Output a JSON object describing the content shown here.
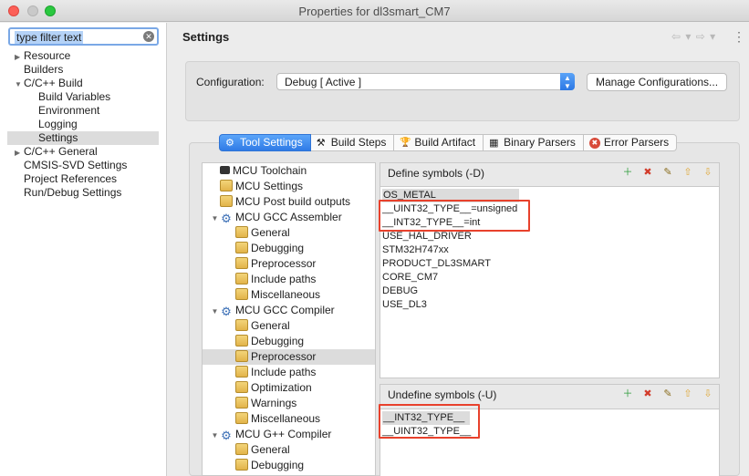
{
  "window": {
    "title": "Properties for dl3smart_CM7"
  },
  "filter": {
    "text": "type filter text"
  },
  "nav_tree": [
    {
      "label": "Resource",
      "twisty": "▶"
    },
    {
      "label": "Builders",
      "twisty": ""
    },
    {
      "label": "C/C++ Build",
      "twisty": "▼"
    },
    {
      "label": "Build Variables",
      "twisty": ""
    },
    {
      "label": "Environment",
      "twisty": ""
    },
    {
      "label": "Logging",
      "twisty": ""
    },
    {
      "label": "Settings",
      "twisty": ""
    },
    {
      "label": "C/C++ General",
      "twisty": "▶"
    },
    {
      "label": "CMSIS-SVD Settings",
      "twisty": ""
    },
    {
      "label": "Project References",
      "twisty": ""
    },
    {
      "label": "Run/Debug Settings",
      "twisty": ""
    }
  ],
  "page": {
    "title": "Settings",
    "nav_icons": "⇦ ▾ ⇨ ▾",
    "menu_icon": "⋮"
  },
  "config": {
    "label": "Configuration:",
    "value": "Debug  [ Active ]",
    "manage_label": "Manage Configurations..."
  },
  "tabs": [
    {
      "label": "Tool Settings",
      "icon": "⚙"
    },
    {
      "label": "Build Steps",
      "icon": "⚒"
    },
    {
      "label": "Build Artifact",
      "icon": "🏆"
    },
    {
      "label": "Binary Parsers",
      "icon": "▦"
    },
    {
      "label": "Error Parsers",
      "icon": "✖"
    }
  ],
  "settings_tree": [
    {
      "label": "MCU Toolchain",
      "icon": "chip",
      "twisty": ""
    },
    {
      "label": "MCU Settings",
      "icon": "folder",
      "twisty": ""
    },
    {
      "label": "MCU Post build outputs",
      "icon": "folder",
      "twisty": ""
    },
    {
      "label": "MCU GCC Assembler",
      "icon": "gear",
      "twisty": "▼"
    },
    {
      "label": "General",
      "icon": "folder",
      "twisty": ""
    },
    {
      "label": "Debugging",
      "icon": "folder",
      "twisty": ""
    },
    {
      "label": "Preprocessor",
      "icon": "folder",
      "twisty": ""
    },
    {
      "label": "Include paths",
      "icon": "folder",
      "twisty": ""
    },
    {
      "label": "Miscellaneous",
      "icon": "folder",
      "twisty": ""
    },
    {
      "label": "MCU GCC Compiler",
      "icon": "gear",
      "twisty": "▼"
    },
    {
      "label": "General",
      "icon": "folder",
      "twisty": ""
    },
    {
      "label": "Debugging",
      "icon": "folder",
      "twisty": ""
    },
    {
      "label": "Preprocessor",
      "icon": "folder",
      "twisty": ""
    },
    {
      "label": "Include paths",
      "icon": "folder",
      "twisty": ""
    },
    {
      "label": "Optimization",
      "icon": "folder",
      "twisty": ""
    },
    {
      "label": "Warnings",
      "icon": "folder",
      "twisty": ""
    },
    {
      "label": "Miscellaneous",
      "icon": "folder",
      "twisty": ""
    },
    {
      "label": "MCU G++ Compiler",
      "icon": "gear",
      "twisty": "▼"
    },
    {
      "label": "General",
      "icon": "folder",
      "twisty": ""
    },
    {
      "label": "Debugging",
      "icon": "folder",
      "twisty": ""
    }
  ],
  "define_symbols": {
    "title": "Define symbols (-D)",
    "items": [
      "OS_METAL",
      "__UINT32_TYPE__=unsigned",
      "__INT32_TYPE__=int",
      "USE_HAL_DRIVER",
      "STM32H747xx",
      "PRODUCT_DL3SMART",
      "CORE_CM7",
      "DEBUG",
      "USE_DL3"
    ]
  },
  "undefine_symbols": {
    "title": "Undefine symbols (-U)",
    "items": [
      "__INT32_TYPE__",
      "__UINT32_TYPE__"
    ]
  },
  "tool_icons": [
    "add-icon",
    "delete-icon",
    "edit-icon",
    "move-up-icon",
    "move-down-icon"
  ],
  "colors": {
    "highlight_box": "#e8412c",
    "active_tab": "#2f7be6",
    "selection": "#dcdcdc"
  }
}
